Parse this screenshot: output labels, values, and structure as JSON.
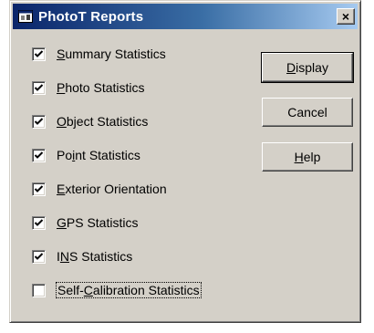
{
  "window": {
    "title": "PhotoT Reports",
    "icon": "app-window-icon",
    "close_label": "×"
  },
  "options": [
    {
      "pre": "",
      "key": "S",
      "post": "ummary Statistics",
      "checked": true
    },
    {
      "pre": "",
      "key": "P",
      "post": "hoto Statistics",
      "checked": true
    },
    {
      "pre": "",
      "key": "O",
      "post": "bject Statistics",
      "checked": true
    },
    {
      "pre": "Po",
      "key": "i",
      "post": "nt Statistics",
      "checked": true
    },
    {
      "pre": "",
      "key": "E",
      "post": "xterior Orientation",
      "checked": true
    },
    {
      "pre": "",
      "key": "G",
      "post": "PS Statistics",
      "checked": true
    },
    {
      "pre": "I",
      "key": "N",
      "post": "S Statistics",
      "checked": true
    },
    {
      "pre": "Self-",
      "key": "C",
      "post": "alibration Statistics",
      "checked": false
    }
  ],
  "buttons": {
    "display": {
      "pre": "",
      "key": "D",
      "post": "isplay"
    },
    "cancel": {
      "label": "Cancel"
    },
    "help": {
      "pre": "",
      "key": "H",
      "post": "elp"
    }
  },
  "colors": {
    "title_start": "#0a246a",
    "title_end": "#a6caf0",
    "face": "#d4d0c8"
  }
}
